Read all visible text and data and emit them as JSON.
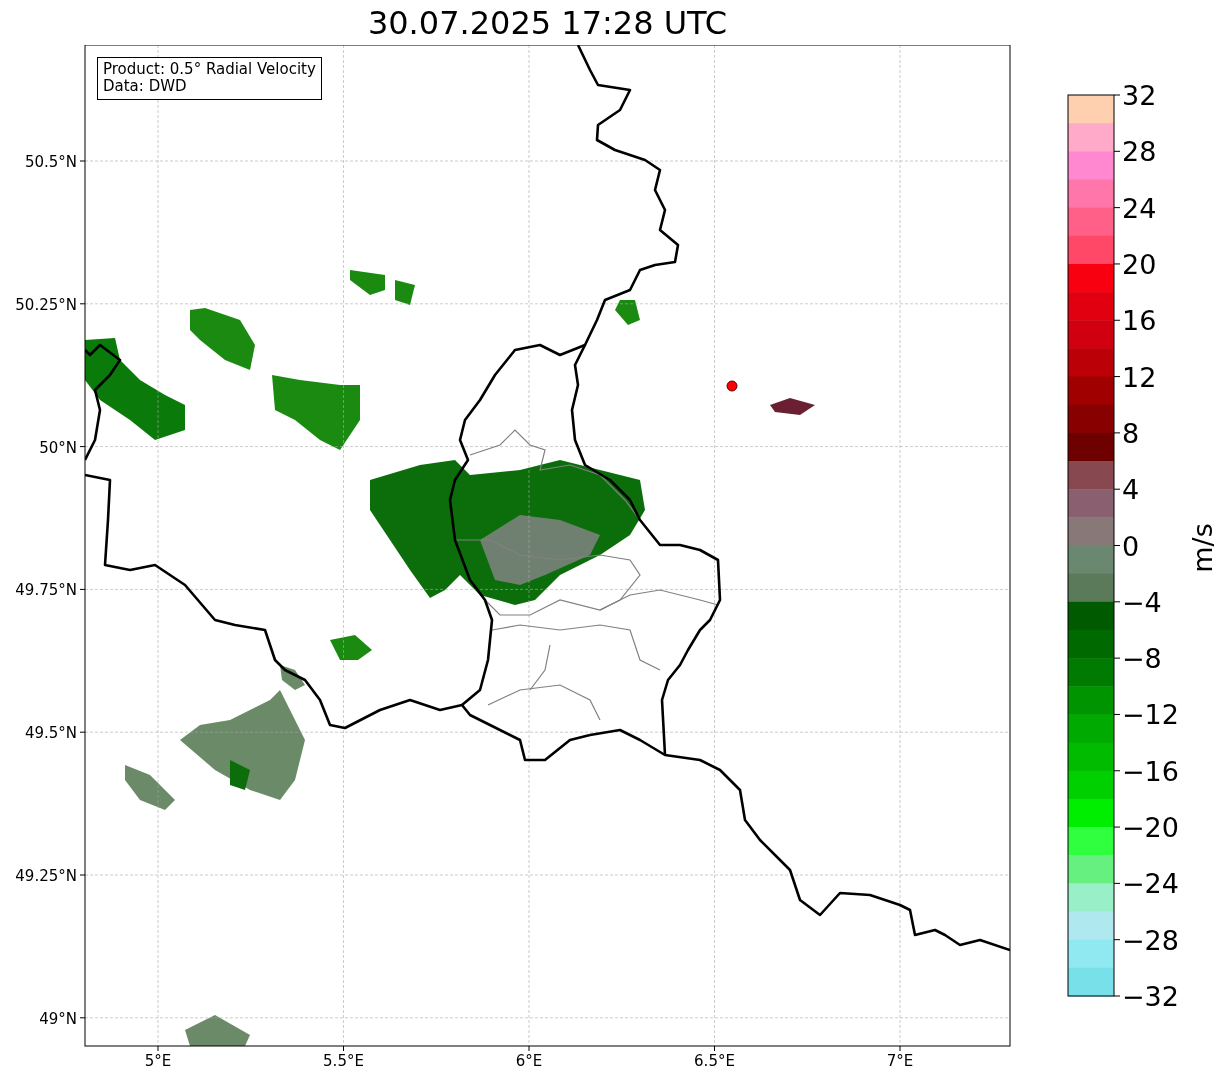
{
  "title": "30.07.2025 17:28 UTC",
  "legend": [
    "Product: 0.5° Radial Velocity",
    "Data: DWD"
  ],
  "map": {
    "lon_ticks": [
      "5°E",
      "5.5°E",
      "6°E",
      "6.5°E",
      "7°E"
    ],
    "lat_ticks": [
      "50.5°N",
      "50.25°N",
      "50°N",
      "49.75°N",
      "49.5°N",
      "49.25°N",
      "49°N"
    ]
  },
  "colorbar": {
    "label": "m/s",
    "ticks": [
      "32",
      "28",
      "24",
      "20",
      "16",
      "12",
      "8",
      "4",
      "0",
      "−4",
      "−8",
      "−12",
      "−16",
      "−20",
      "−24",
      "−28",
      "−32"
    ],
    "bands": [
      {
        "color": "#ffd0b0"
      },
      {
        "color": "#ffaac8"
      },
      {
        "color": "#ff88d0"
      },
      {
        "color": "#ff77aa"
      },
      {
        "color": "#ff6088"
      },
      {
        "color": "#ff4868"
      },
      {
        "color": "#f80010"
      },
      {
        "color": "#e00010"
      },
      {
        "color": "#d00010"
      },
      {
        "color": "#bb0008"
      },
      {
        "color": "#a00000"
      },
      {
        "color": "#880000"
      },
      {
        "color": "#6e0000"
      },
      {
        "color": "#884850"
      },
      {
        "color": "#8a6070"
      },
      {
        "color": "#887878"
      },
      {
        "color": "#6a8870"
      },
      {
        "color": "#5a7a5a"
      },
      {
        "color": "#005a00"
      },
      {
        "color": "#006a00"
      },
      {
        "color": "#007a00"
      },
      {
        "color": "#009400"
      },
      {
        "color": "#00aa00"
      },
      {
        "color": "#00bb00"
      },
      {
        "color": "#00d000"
      },
      {
        "color": "#00ee00"
      },
      {
        "color": "#30ff40"
      },
      {
        "color": "#66f080"
      },
      {
        "color": "#99f0c8"
      },
      {
        "color": "#b0e8f0"
      },
      {
        "color": "#90e8f0"
      },
      {
        "color": "#78e0e8"
      }
    ]
  }
}
